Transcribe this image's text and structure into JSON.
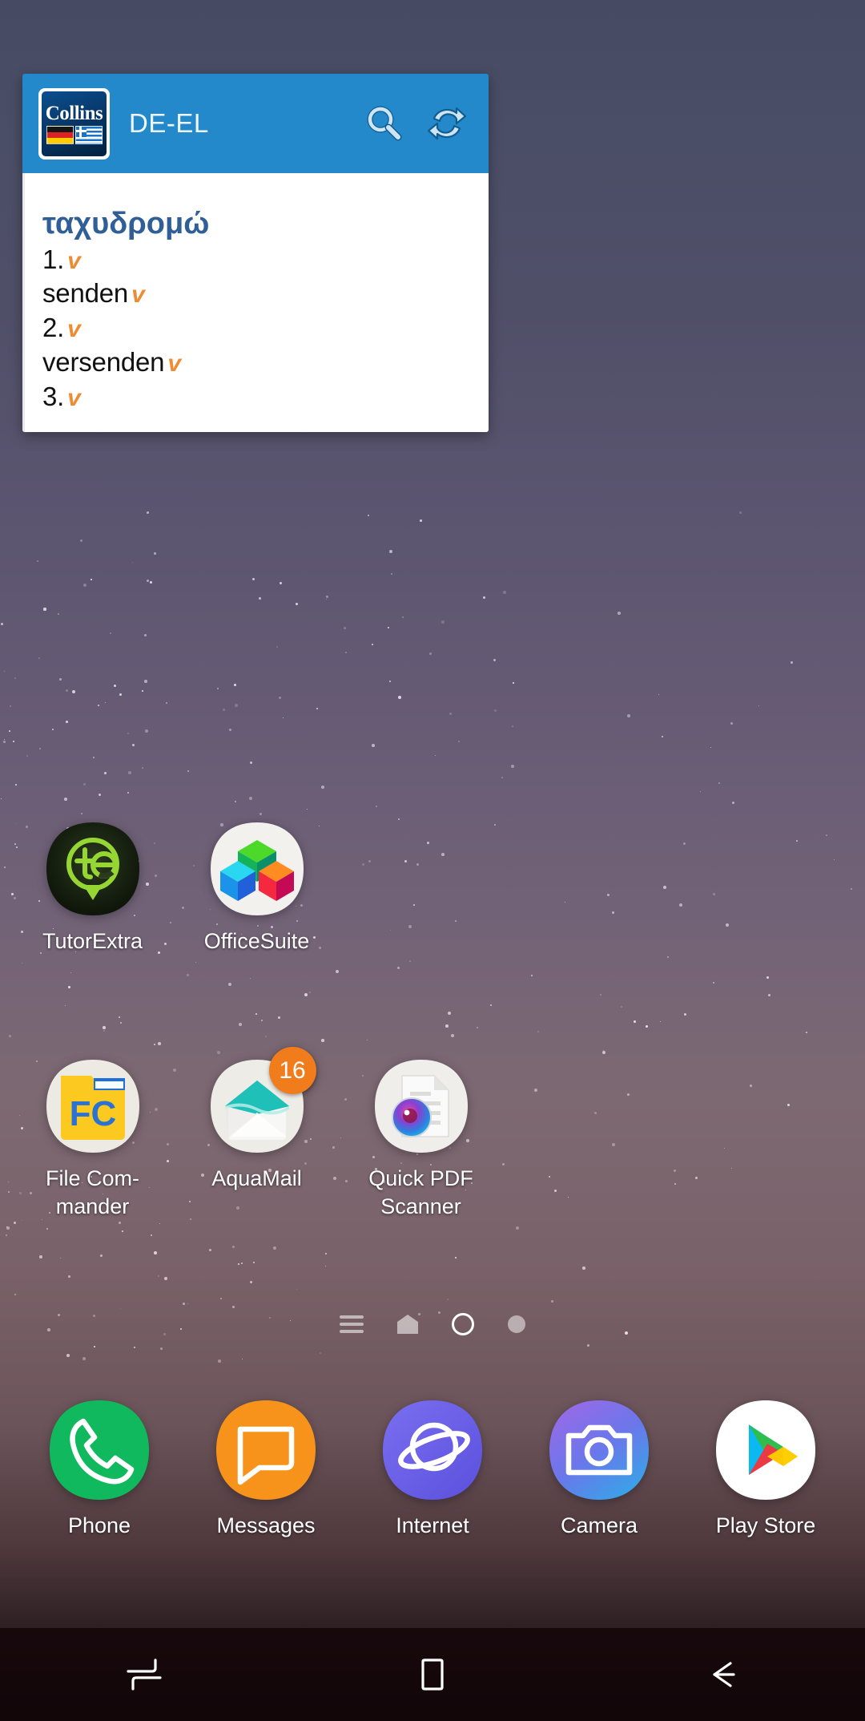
{
  "widget": {
    "app_name": "Collins",
    "language_pair": "DE-EL",
    "search_icon": "search-icon",
    "refresh_icon": "refresh-icon",
    "headword": "ταχυδρομώ",
    "entries": [
      {
        "number": "1.",
        "pos": "v",
        "translation": "",
        "translation_pos": ""
      },
      {
        "number": "",
        "pos": "",
        "translation": "senden",
        "translation_pos": "v"
      },
      {
        "number": "2.",
        "pos": "v",
        "translation": "",
        "translation_pos": ""
      },
      {
        "number": "",
        "pos": "",
        "translation": "versenden",
        "translation_pos": "v"
      },
      {
        "number": "3.",
        "pos": "v",
        "translation": "",
        "translation_pos": ""
      }
    ],
    "colors": {
      "header_bg": "#2489ca",
      "headword": "#2f5f96",
      "pos": "#ef8b33"
    }
  },
  "home_screen": {
    "apps_row1": [
      {
        "label": "TutorExtra",
        "icon": "tutorextra-icon"
      },
      {
        "label": "OfficeSuite",
        "icon": "officesuite-icon"
      }
    ],
    "apps_row2": [
      {
        "label": "File Com-\nmander",
        "icon": "file-commander-icon"
      },
      {
        "label": "AquaMail",
        "icon": "aquamail-icon",
        "badge": "16"
      },
      {
        "label": "Quick PDF\nScanner",
        "icon": "quick-pdf-scanner-icon"
      }
    ],
    "page_indicators": [
      {
        "type": "lines",
        "active": false
      },
      {
        "type": "home",
        "active": false
      },
      {
        "type": "circle",
        "active": true
      },
      {
        "type": "dot",
        "active": false
      }
    ],
    "dock": [
      {
        "label": "Phone",
        "icon": "phone-icon",
        "color": "#11b95e"
      },
      {
        "label": "Messages",
        "icon": "messages-icon",
        "color": "#f7931a"
      },
      {
        "label": "Internet",
        "icon": "internet-icon",
        "color": "#6a63e8"
      },
      {
        "label": "Camera",
        "icon": "camera-icon",
        "color": "#7a6ae8"
      },
      {
        "label": "Play Store",
        "icon": "play-store-icon",
        "color": "#ffffff"
      }
    ]
  },
  "navbar": {
    "recents": "recents-icon",
    "home": "home-icon",
    "back": "back-icon"
  }
}
